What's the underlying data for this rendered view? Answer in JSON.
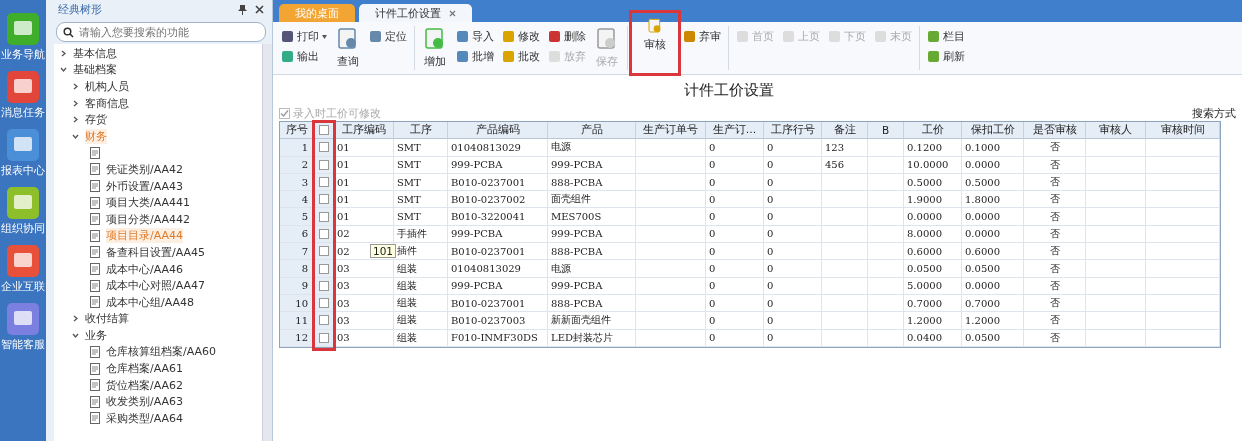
{
  "rail": [
    {
      "label": "业务导航",
      "kind": "nav"
    },
    {
      "label": "消息任务",
      "kind": "msg"
    },
    {
      "label": "报表中心",
      "kind": "report"
    },
    {
      "label": "组织协同",
      "kind": "org"
    },
    {
      "label": "企业互联",
      "kind": "link"
    },
    {
      "label": "智能客服",
      "kind": "service"
    }
  ],
  "sidebar": {
    "title": "经典树形",
    "search": {
      "placeholder": "请输入您要搜索的功能"
    },
    "tree": [
      {
        "label": "基本信息",
        "expanded": false,
        "selected": false
      },
      {
        "label": "基础档案",
        "expanded": true,
        "selected": false,
        "children": [
          {
            "label": "机构人员",
            "expanded": false,
            "selected": false
          },
          {
            "label": "客商信息",
            "expanded": false,
            "selected": false
          },
          {
            "label": "存货",
            "expanded": false,
            "selected": false
          },
          {
            "label": "财务",
            "expanded": true,
            "selected": true,
            "children": [
              {
                "kind": "doc"
              },
              {
                "kind": "doc",
                "label": "凭证类别/AA42",
                "selected": false
              },
              {
                "kind": "doc",
                "label": "外币设置/AA43",
                "selected": false
              },
              {
                "kind": "doc",
                "label": "项目大类/AA441",
                "selected": false
              },
              {
                "kind": "doc",
                "label": "项目分类/AA442",
                "selected": false
              },
              {
                "kind": "doc",
                "label": "项目目录/AA44",
                "selected": true
              },
              {
                "kind": "doc",
                "label": "备查科目设置/AA45",
                "selected": false
              },
              {
                "kind": "doc",
                "label": "成本中心/AA46",
                "selected": false
              },
              {
                "kind": "doc",
                "label": "成本中心对照/AA47",
                "selected": false
              },
              {
                "kind": "doc",
                "label": "成本中心组/AA48",
                "selected": false
              }
            ]
          },
          {
            "label": "收付结算",
            "expanded": false,
            "selected": false
          },
          {
            "label": "业务",
            "expanded": true,
            "selected": false,
            "children": [
              {
                "kind": "doc",
                "label": "仓库核算组档案/AA60",
                "selected": false
              },
              {
                "kind": "doc",
                "label": "仓库档案/AA61",
                "selected": false
              },
              {
                "kind": "doc",
                "label": "货位档案/AA62",
                "selected": false
              },
              {
                "kind": "doc",
                "label": "收发类别/AA63",
                "selected": false
              },
              {
                "kind": "doc",
                "label": "采购类型/AA64",
                "selected": false
              }
            ]
          }
        ]
      }
    ]
  },
  "tabs": [
    {
      "label": "我的桌面",
      "selected": false
    },
    {
      "label": "计件工价设置",
      "selected": true
    }
  ],
  "toolbar": [
    {
      "kind": "stack",
      "items": [
        {
          "label": "打印",
          "dropdown": true,
          "disabled": false
        },
        {
          "label": "输出",
          "dropdown": false,
          "disabled": false
        }
      ]
    },
    {
      "kind": "large",
      "label": "查询",
      "disabled": false,
      "highlighted": false
    },
    {
      "kind": "stack",
      "items": [
        {
          "label": "定位",
          "dropdown": false,
          "disabled": false
        }
      ]
    },
    {
      "kind": "sep"
    },
    {
      "kind": "large",
      "label": "增加",
      "disabled": false,
      "highlighted": false
    },
    {
      "kind": "stack",
      "items": [
        {
          "label": "导入",
          "dropdown": false,
          "disabled": false
        },
        {
          "label": "批增",
          "dropdown": false,
          "disabled": false
        }
      ]
    },
    {
      "kind": "stack",
      "items": [
        {
          "label": "修改",
          "dropdown": false,
          "disabled": false
        },
        {
          "label": "批改",
          "dropdown": false,
          "disabled": false
        }
      ]
    },
    {
      "kind": "stack",
      "items": [
        {
          "label": "删除",
          "dropdown": false,
          "disabled": false
        },
        {
          "label": "放弃",
          "dropdown": false,
          "disabled": true
        }
      ]
    },
    {
      "kind": "large",
      "label": "保存",
      "disabled": true,
      "highlighted": false
    },
    {
      "kind": "sep"
    },
    {
      "kind": "large",
      "label": "审核",
      "disabled": false,
      "highlighted": true
    },
    {
      "kind": "stack",
      "items": [
        {
          "label": "弃审",
          "dropdown": false,
          "disabled": false
        }
      ]
    },
    {
      "kind": "sep"
    },
    {
      "kind": "stack",
      "items": [
        {
          "label": "首页",
          "dropdown": false,
          "disabled": true
        }
      ]
    },
    {
      "kind": "stack",
      "items": [
        {
          "label": "上页",
          "dropdown": false,
          "disabled": true
        }
      ]
    },
    {
      "kind": "stack",
      "items": [
        {
          "label": "下页",
          "dropdown": false,
          "disabled": true
        }
      ]
    },
    {
      "kind": "stack",
      "items": [
        {
          "label": "末页",
          "dropdown": false,
          "disabled": true
        }
      ]
    },
    {
      "kind": "sep"
    },
    {
      "kind": "stack",
      "items": [
        {
          "label": "栏目",
          "dropdown": false,
          "disabled": false
        },
        {
          "label": "刷新",
          "dropdown": false,
          "disabled": false
        }
      ]
    }
  ],
  "page_title": "计件工价设置",
  "editable_option": {
    "label": "录入时工价可修改",
    "checked": true,
    "disabled": true
  },
  "search_mode_label": "搜索方式",
  "table": {
    "checkbox_column_highlighted": true,
    "select_all_checked": false,
    "columns": [
      "序号",
      "工序编码",
      "工序",
      "产品编码",
      "产品",
      "生产订单号",
      "生产订…",
      "工序行号",
      "备注",
      "B",
      "工价",
      "保扣工价",
      "是否审核",
      "审核人",
      "审核时间"
    ],
    "rows": [
      {
        "checked": false,
        "cells": [
          "1",
          "01",
          "SMT",
          "01040813029",
          "电源",
          "",
          "0",
          "0",
          "123",
          "",
          "0.1200",
          "0.1000",
          "否",
          "",
          ""
        ]
      },
      {
        "checked": false,
        "cells": [
          "2",
          "01",
          "SMT",
          "999-PCBA",
          "999-PCBA",
          "",
          "0",
          "0",
          "456",
          "",
          "10.0000",
          "0.0000",
          "否",
          "",
          ""
        ]
      },
      {
        "checked": false,
        "cells": [
          "3",
          "01",
          "SMT",
          "B010-0237001",
          "888-PCBA",
          "",
          "0",
          "0",
          "",
          "",
          "0.5000",
          "0.5000",
          "否",
          "",
          ""
        ]
      },
      {
        "checked": false,
        "cells": [
          "4",
          "01",
          "SMT",
          "B010-0237002",
          "面壳组件",
          "",
          "0",
          "0",
          "",
          "",
          "1.9000",
          "1.8000",
          "否",
          "",
          ""
        ]
      },
      {
        "checked": false,
        "cells": [
          "5",
          "01",
          "SMT",
          "B010-3220041",
          "MES700S",
          "",
          "0",
          "0",
          "",
          "",
          "0.0000",
          "0.0000",
          "否",
          "",
          ""
        ]
      },
      {
        "checked": false,
        "cells": [
          "6",
          "02",
          "手插件",
          "999-PCBA",
          "999-PCBA",
          "",
          "0",
          "0",
          "",
          "",
          "8.0000",
          "0.0000",
          "否",
          "",
          ""
        ]
      },
      {
        "checked": false,
        "cells": [
          "7",
          "02",
          "插件",
          "B010-0237001",
          "888-PCBA",
          "",
          "0",
          "0",
          "",
          "",
          "0.6000",
          "0.6000",
          "否",
          "",
          ""
        ]
      },
      {
        "checked": false,
        "cells": [
          "8",
          "03",
          "组装",
          "01040813029",
          "电源",
          "",
          "0",
          "0",
          "",
          "",
          "0.0500",
          "0.0500",
          "否",
          "",
          ""
        ]
      },
      {
        "checked": false,
        "cells": [
          "9",
          "03",
          "组装",
          "999-PCBA",
          "999-PCBA",
          "",
          "0",
          "0",
          "",
          "",
          "5.0000",
          "0.0000",
          "否",
          "",
          ""
        ]
      },
      {
        "checked": false,
        "cells": [
          "10",
          "03",
          "组装",
          "B010-0237001",
          "888-PCBA",
          "",
          "0",
          "0",
          "",
          "",
          "0.7000",
          "0.7000",
          "否",
          "",
          ""
        ]
      },
      {
        "checked": false,
        "cells": [
          "11",
          "03",
          "组装",
          "B010-0237003",
          "新新面壳组件",
          "",
          "0",
          "0",
          "",
          "",
          "1.2000",
          "1.2000",
          "否",
          "",
          ""
        ]
      },
      {
        "checked": false,
        "cells": [
          "12",
          "03",
          "组装",
          "F010-INMF30DS",
          "LED封装芯片",
          "",
          "0",
          "0",
          "",
          "",
          "0.0400",
          "0.0500",
          "否",
          "",
          ""
        ]
      }
    ]
  },
  "tooltip": "101"
}
